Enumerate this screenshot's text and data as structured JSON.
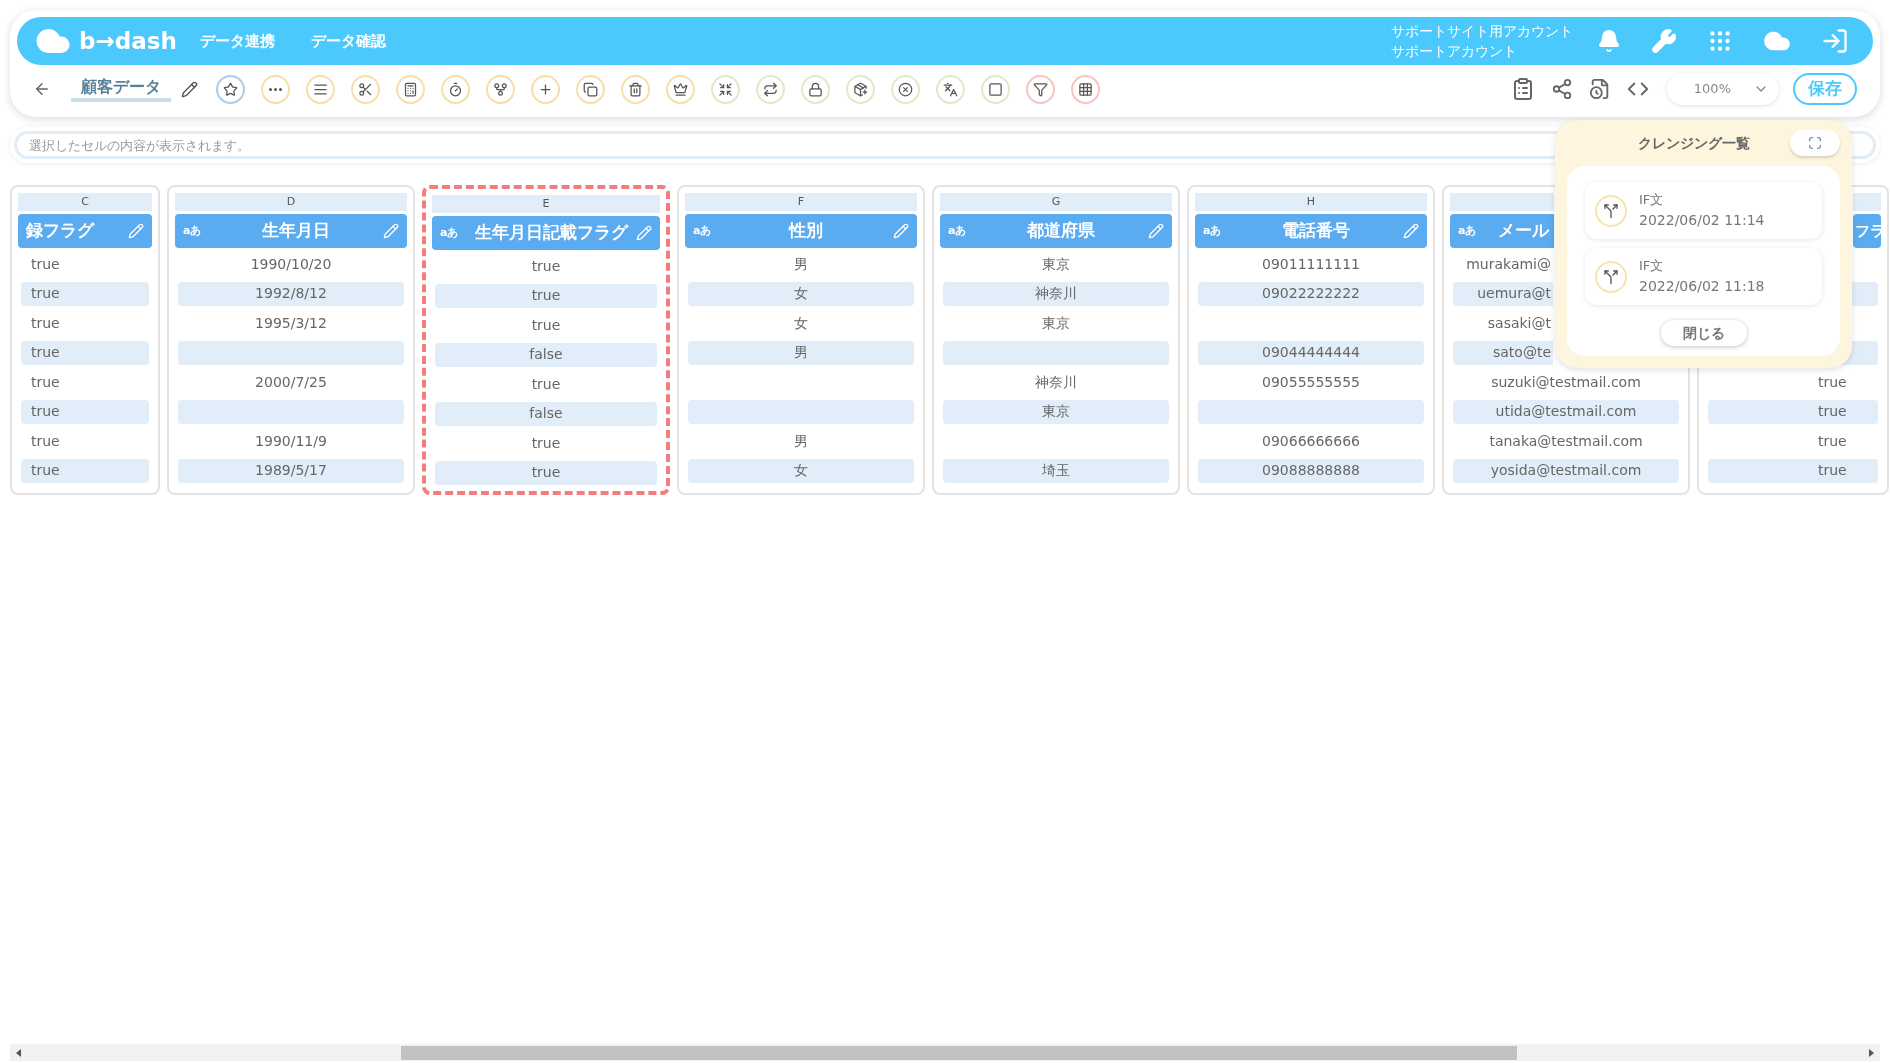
{
  "header": {
    "logo": "b→dash",
    "nav": [
      {
        "label": "データ連携"
      },
      {
        "label": "データ確認"
      }
    ],
    "account": [
      "サポートサイト用アカウント",
      "サポートアカウント"
    ]
  },
  "toolbar": {
    "title": "顧客データ",
    "zoom": "100%",
    "save": "保存"
  },
  "formula_bar": {
    "placeholder": "選択したセルの内容が表示されます。"
  },
  "columns": [
    {
      "letter": "C",
      "name": "録フラグ",
      "selected": false,
      "cells": [
        "true",
        "true",
        "true",
        "true",
        "true",
        "true",
        "true",
        "true"
      ]
    },
    {
      "letter": "D",
      "name": "生年月日",
      "badge": "aあ",
      "selected": false,
      "cells": [
        "1990/10/20",
        "1992/8/12",
        "1995/3/12",
        null,
        "2000/7/25",
        null,
        "1990/11/9",
        "1989/5/17"
      ]
    },
    {
      "letter": "E",
      "name": "生年月日記載フラグ",
      "badge": "aあ",
      "selected": true,
      "cells": [
        "true",
        "true",
        "true",
        "false",
        "true",
        "false",
        "true",
        "true"
      ]
    },
    {
      "letter": "F",
      "name": "性別",
      "badge": "aあ",
      "selected": false,
      "cells": [
        "男",
        "女",
        "女",
        "男",
        null,
        null,
        "男",
        "女"
      ]
    },
    {
      "letter": "G",
      "name": "都道府県",
      "badge": "aあ",
      "selected": false,
      "cells": [
        "東京",
        "神奈川",
        "東京",
        null,
        "神奈川",
        "東京",
        null,
        "埼玉"
      ]
    },
    {
      "letter": "H",
      "name": "電話番号",
      "badge": "aあ",
      "selected": false,
      "cells": [
        "09011111111",
        "09022222222",
        null,
        "09044444444",
        "09055555555",
        null,
        "09066666666",
        "09088888888"
      ]
    },
    {
      "name": "メール",
      "badge": "aあ",
      "selected": false,
      "cells": [
        "murakami@",
        "uemura@t",
        "sasaki@t",
        "sato@te",
        "suzuki@testmail.com",
        "utida@testmail.com",
        "tanaka@testmail.com",
        "yosida@testmail.com"
      ]
    },
    {
      "name": "フラ",
      "selected": false,
      "cells": [
        null,
        null,
        null,
        null,
        "true",
        "true",
        "true",
        "true"
      ]
    }
  ],
  "cleansing_panel": {
    "title": "クレンジング一覧",
    "items": [
      {
        "name": "IF文",
        "time": "2022/06/02 11:14"
      },
      {
        "name": "IF文",
        "time": "2022/06/02 11:18"
      }
    ],
    "close": "閉じる"
  }
}
